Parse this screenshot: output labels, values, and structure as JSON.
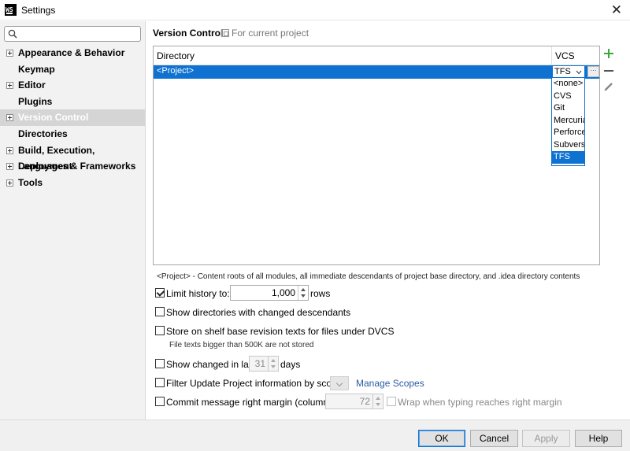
{
  "window": {
    "app_icon_text": "WS",
    "title": "Settings",
    "close_glyph": "✕"
  },
  "sidebar": {
    "search": {
      "value": "",
      "placeholder": ""
    },
    "items": [
      {
        "label": "Appearance & Behavior",
        "expandable": true
      },
      {
        "label": "Keymap",
        "expandable": false
      },
      {
        "label": "Editor",
        "expandable": true
      },
      {
        "label": "Plugins",
        "expandable": false
      },
      {
        "label": "Version Control",
        "expandable": true,
        "selected": true
      },
      {
        "label": "Directories",
        "expandable": false
      },
      {
        "label": "Build, Execution, Deployment",
        "expandable": true
      },
      {
        "label": "Languages & Frameworks",
        "expandable": true
      },
      {
        "label": "Tools",
        "expandable": true
      }
    ]
  },
  "main": {
    "title": "Version Control",
    "scope_label": "For current project",
    "table": {
      "headers": {
        "directory": "Directory",
        "vcs": "VCS"
      },
      "rows": [
        {
          "directory": "<Project>",
          "vcs": "TFS"
        }
      ],
      "ellipsis": "···"
    },
    "vcs_dropdown": {
      "options": [
        "<none>",
        "CVS",
        "Git",
        "Mercurial",
        "Perforce",
        "Subversion",
        "TFS"
      ],
      "selected": "TFS"
    },
    "description": "<Project> - Content roots of all modules, all immediate descendants of project base directory, and .idea directory contents",
    "options": {
      "limit_history": {
        "label": "Limit history to:",
        "checked": true,
        "value": "1,000",
        "suffix": "rows"
      },
      "show_dirs": {
        "label": "Show directories with changed descendants",
        "checked": false
      },
      "store_shelf": {
        "label": "Store on shelf base revision texts for files under DVCS",
        "checked": false,
        "note": "File texts bigger than 500K are not stored"
      },
      "show_changed": {
        "label": "Show changed in last",
        "checked": false,
        "value": "31",
        "suffix": "days"
      },
      "filter_update": {
        "label": "Filter Update Project information by scope",
        "checked": false,
        "link": "Manage Scopes"
      },
      "commit_margin": {
        "label": "Commit message right margin (columns):",
        "checked": false,
        "value": "72",
        "wrap_label": "Wrap when typing reaches right margin"
      }
    }
  },
  "footer": {
    "ok": "OK",
    "cancel": "Cancel",
    "apply": "Apply",
    "help": "Help"
  },
  "colors": {
    "selection": "#0f72d1",
    "sidebar_bg": "#f2f2f2",
    "add_icon": "#3ba63b",
    "link": "#2a5d9f"
  }
}
